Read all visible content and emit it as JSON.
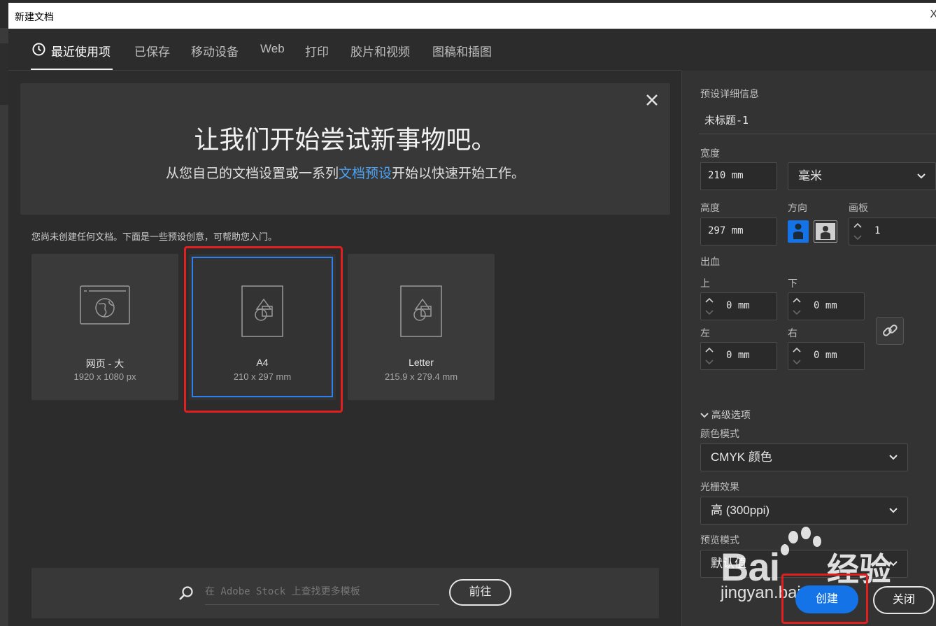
{
  "window": {
    "title": "新建文档",
    "close_glyph": "X"
  },
  "tabs": [
    {
      "label": "最近使用项",
      "active": true
    },
    {
      "label": "已保存"
    },
    {
      "label": "移动设备"
    },
    {
      "label": "Web"
    },
    {
      "label": "打印"
    },
    {
      "label": "胶片和视频"
    },
    {
      "label": "图稿和插图"
    }
  ],
  "hero": {
    "heading": "让我们开始尝试新事物吧。",
    "text_before": "从您自己的文档设置或一系列",
    "link": "文档预设",
    "text_after": "开始以快速开始工作。"
  },
  "hint": "您尚未创建任何文档。下面是一些预设创意，可帮助您入门。",
  "presets": [
    {
      "name": "网页 - 大",
      "size": "1920 x 1080 px",
      "icon": "web-globe-icon"
    },
    {
      "name": "A4",
      "size": "210 x 297 mm",
      "icon": "document-shapes-icon",
      "selected": true
    },
    {
      "name": "Letter",
      "size": "215.9 x 279.4 mm",
      "icon": "document-shapes-icon"
    }
  ],
  "stock": {
    "placeholder": "在 Adobe Stock 上查找更多模板",
    "go_label": "前往"
  },
  "details": {
    "section_label": "预设详细信息",
    "doc_name": "未标题-1",
    "width_label": "宽度",
    "width_value": "210 mm",
    "unit_value": "毫米",
    "height_label": "高度",
    "height_value": "297 mm",
    "orientation_label": "方向",
    "artboards_label": "画板",
    "artboards_value": "1",
    "bleed_label": "出血",
    "bleed_top_label": "上",
    "bleed_top_value": "0 mm",
    "bleed_bottom_label": "下",
    "bleed_bottom_value": "0 mm",
    "bleed_left_label": "左",
    "bleed_left_value": "0 mm",
    "bleed_right_label": "右",
    "bleed_right_value": "0 mm",
    "advanced_label": "高级选项",
    "color_mode_label": "颜色模式",
    "color_mode_value": "CMYK 颜色",
    "raster_label": "光栅效果",
    "raster_value": "高 (300ppi)",
    "preview_label": "预览模式",
    "preview_value": "默认值"
  },
  "actions": {
    "create": "创建",
    "close": "关闭"
  },
  "watermark": {
    "brand": "Bai",
    "brand_cn": "经验",
    "url": "jingyan.baidu.com"
  },
  "colors": {
    "accent": "#1473e6",
    "link": "#4aa3f7",
    "highlight_box": "#e02020",
    "selection": "#2f80ed"
  }
}
